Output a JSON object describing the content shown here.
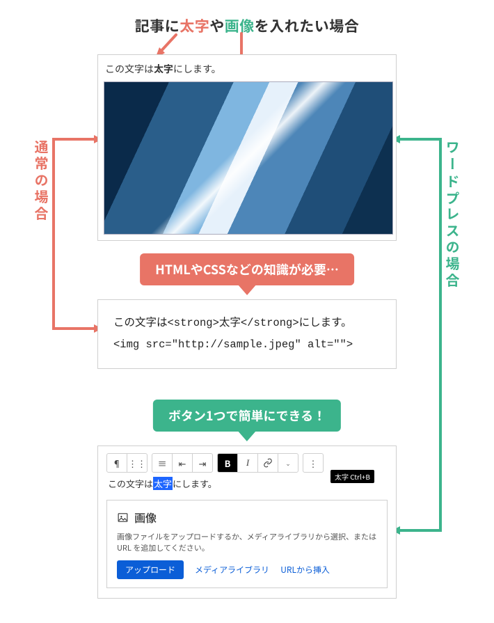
{
  "heading": {
    "pre": "記事に",
    "bold": "太字",
    "mid": "や",
    "img": "画像",
    "post": "を入れたい場合"
  },
  "side_labels": {
    "left": "通常の場合",
    "right": "ワードプレスの場合"
  },
  "preview": {
    "text_pre": "この文字は",
    "text_bold": "太字",
    "text_post": "にします。"
  },
  "caption_red": "HTMLやCSSなどの知識が必要…",
  "caption_green": "ボタン1つで簡単にできる！",
  "code": {
    "line1": "この文字は<strong>太字</strong>にします。",
    "line2": "<img src=\"http://sample.jpeg\" alt=\"\">"
  },
  "wp": {
    "toolbar": {
      "pilcrow": "¶",
      "dots": "⋮⋮",
      "align": "≡",
      "outdent": "⇤",
      "indent": "⇥",
      "bold": "B",
      "italic": "I",
      "link": "link",
      "caret": "⌄",
      "tooltip": "太字 Ctrl+B"
    },
    "line_pre": "この文字は",
    "line_sel": "太字",
    "line_post": "にします。",
    "imgbox": {
      "title": "画像",
      "desc": "画像ファイルをアップロードするか、メディアライブラリから選択、または URL を追加してください。",
      "upload": "アップロード",
      "library": "メディアライブラリ",
      "url": "URLから挿入"
    }
  }
}
